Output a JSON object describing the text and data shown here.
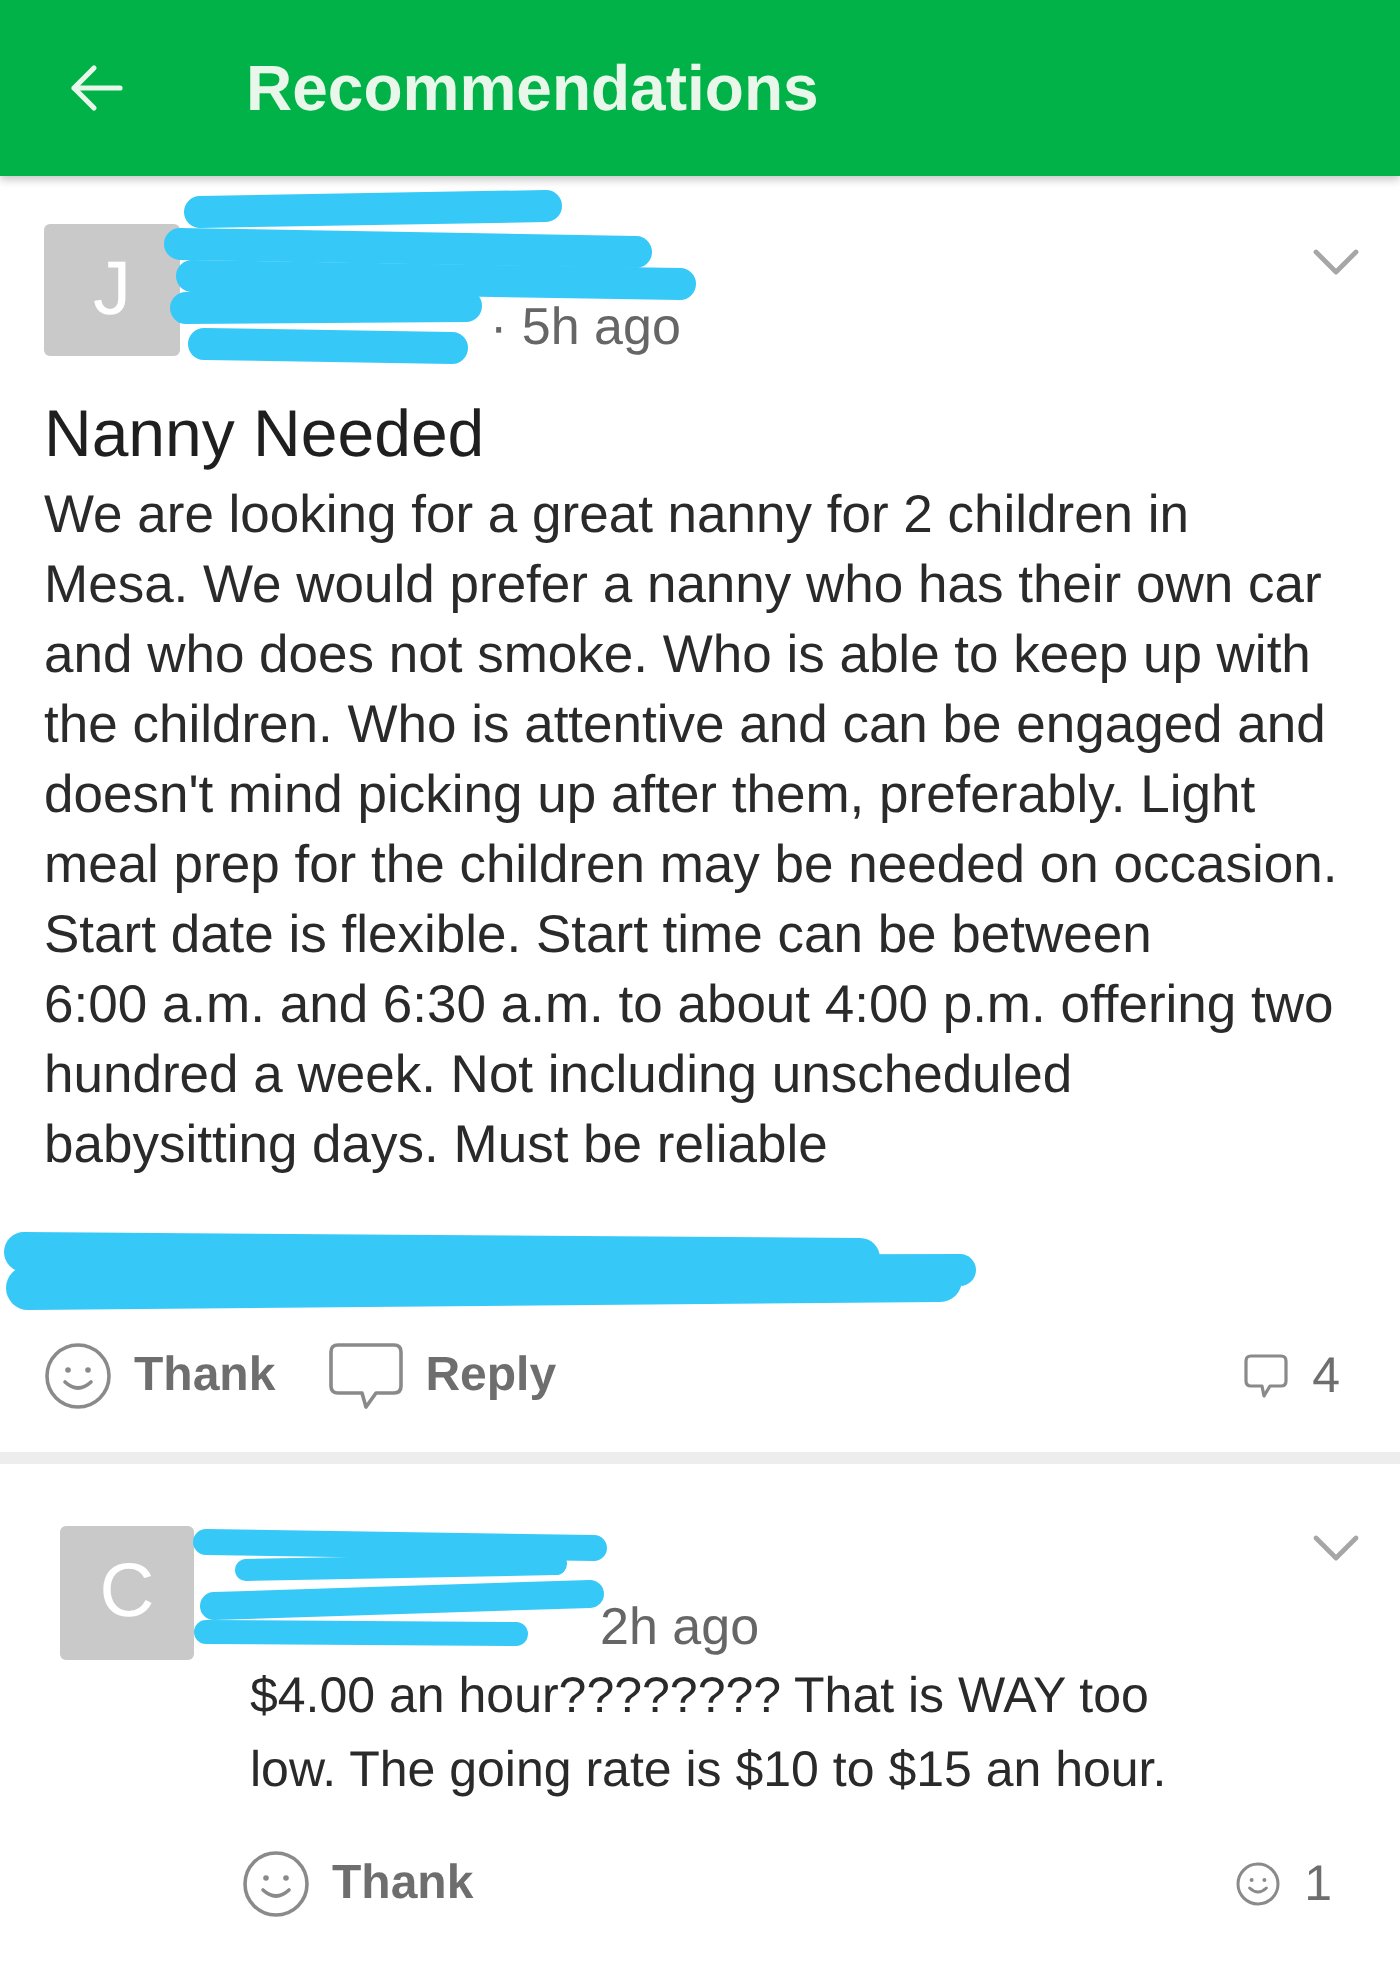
{
  "app_bar": {
    "title": "Recommendations"
  },
  "post": {
    "avatar_letter": "J",
    "author_redacted": true,
    "time": "· 5h ago",
    "title": "Nanny Needed",
    "body": "We are looking for a great nanny for 2 children in Mesa. We would prefer a nanny who has their own car and who does not smoke. Who is able to keep up with the children. Who is attentive and can be engaged and doesn't mind picking up after them, preferably. Light meal prep for the children may be needed on occasion. Start date is flexible. Start time can be between\n6:00 a.m. and 6:30 a.m. to about 4:00 p.m. offering two hundred a week. Not including unscheduled babysitting days. Must be reliable",
    "location_redacted": true,
    "actions": [
      {
        "kind": "thank",
        "label": "Thank"
      },
      {
        "kind": "reply",
        "label": "Reply"
      }
    ],
    "counter": {
      "kind": "replies",
      "value": "4"
    }
  },
  "comments": [
    {
      "avatar_letter": "C",
      "author_redacted": true,
      "time": "2h ago",
      "text": "$4.00 an hour???????? That is WAY too low. The going rate is $10 to $15 an hour.",
      "actions": [
        {
          "kind": "thank",
          "label": "Thank"
        }
      ],
      "counter": {
        "kind": "thanks",
        "value": "1"
      }
    }
  ]
}
